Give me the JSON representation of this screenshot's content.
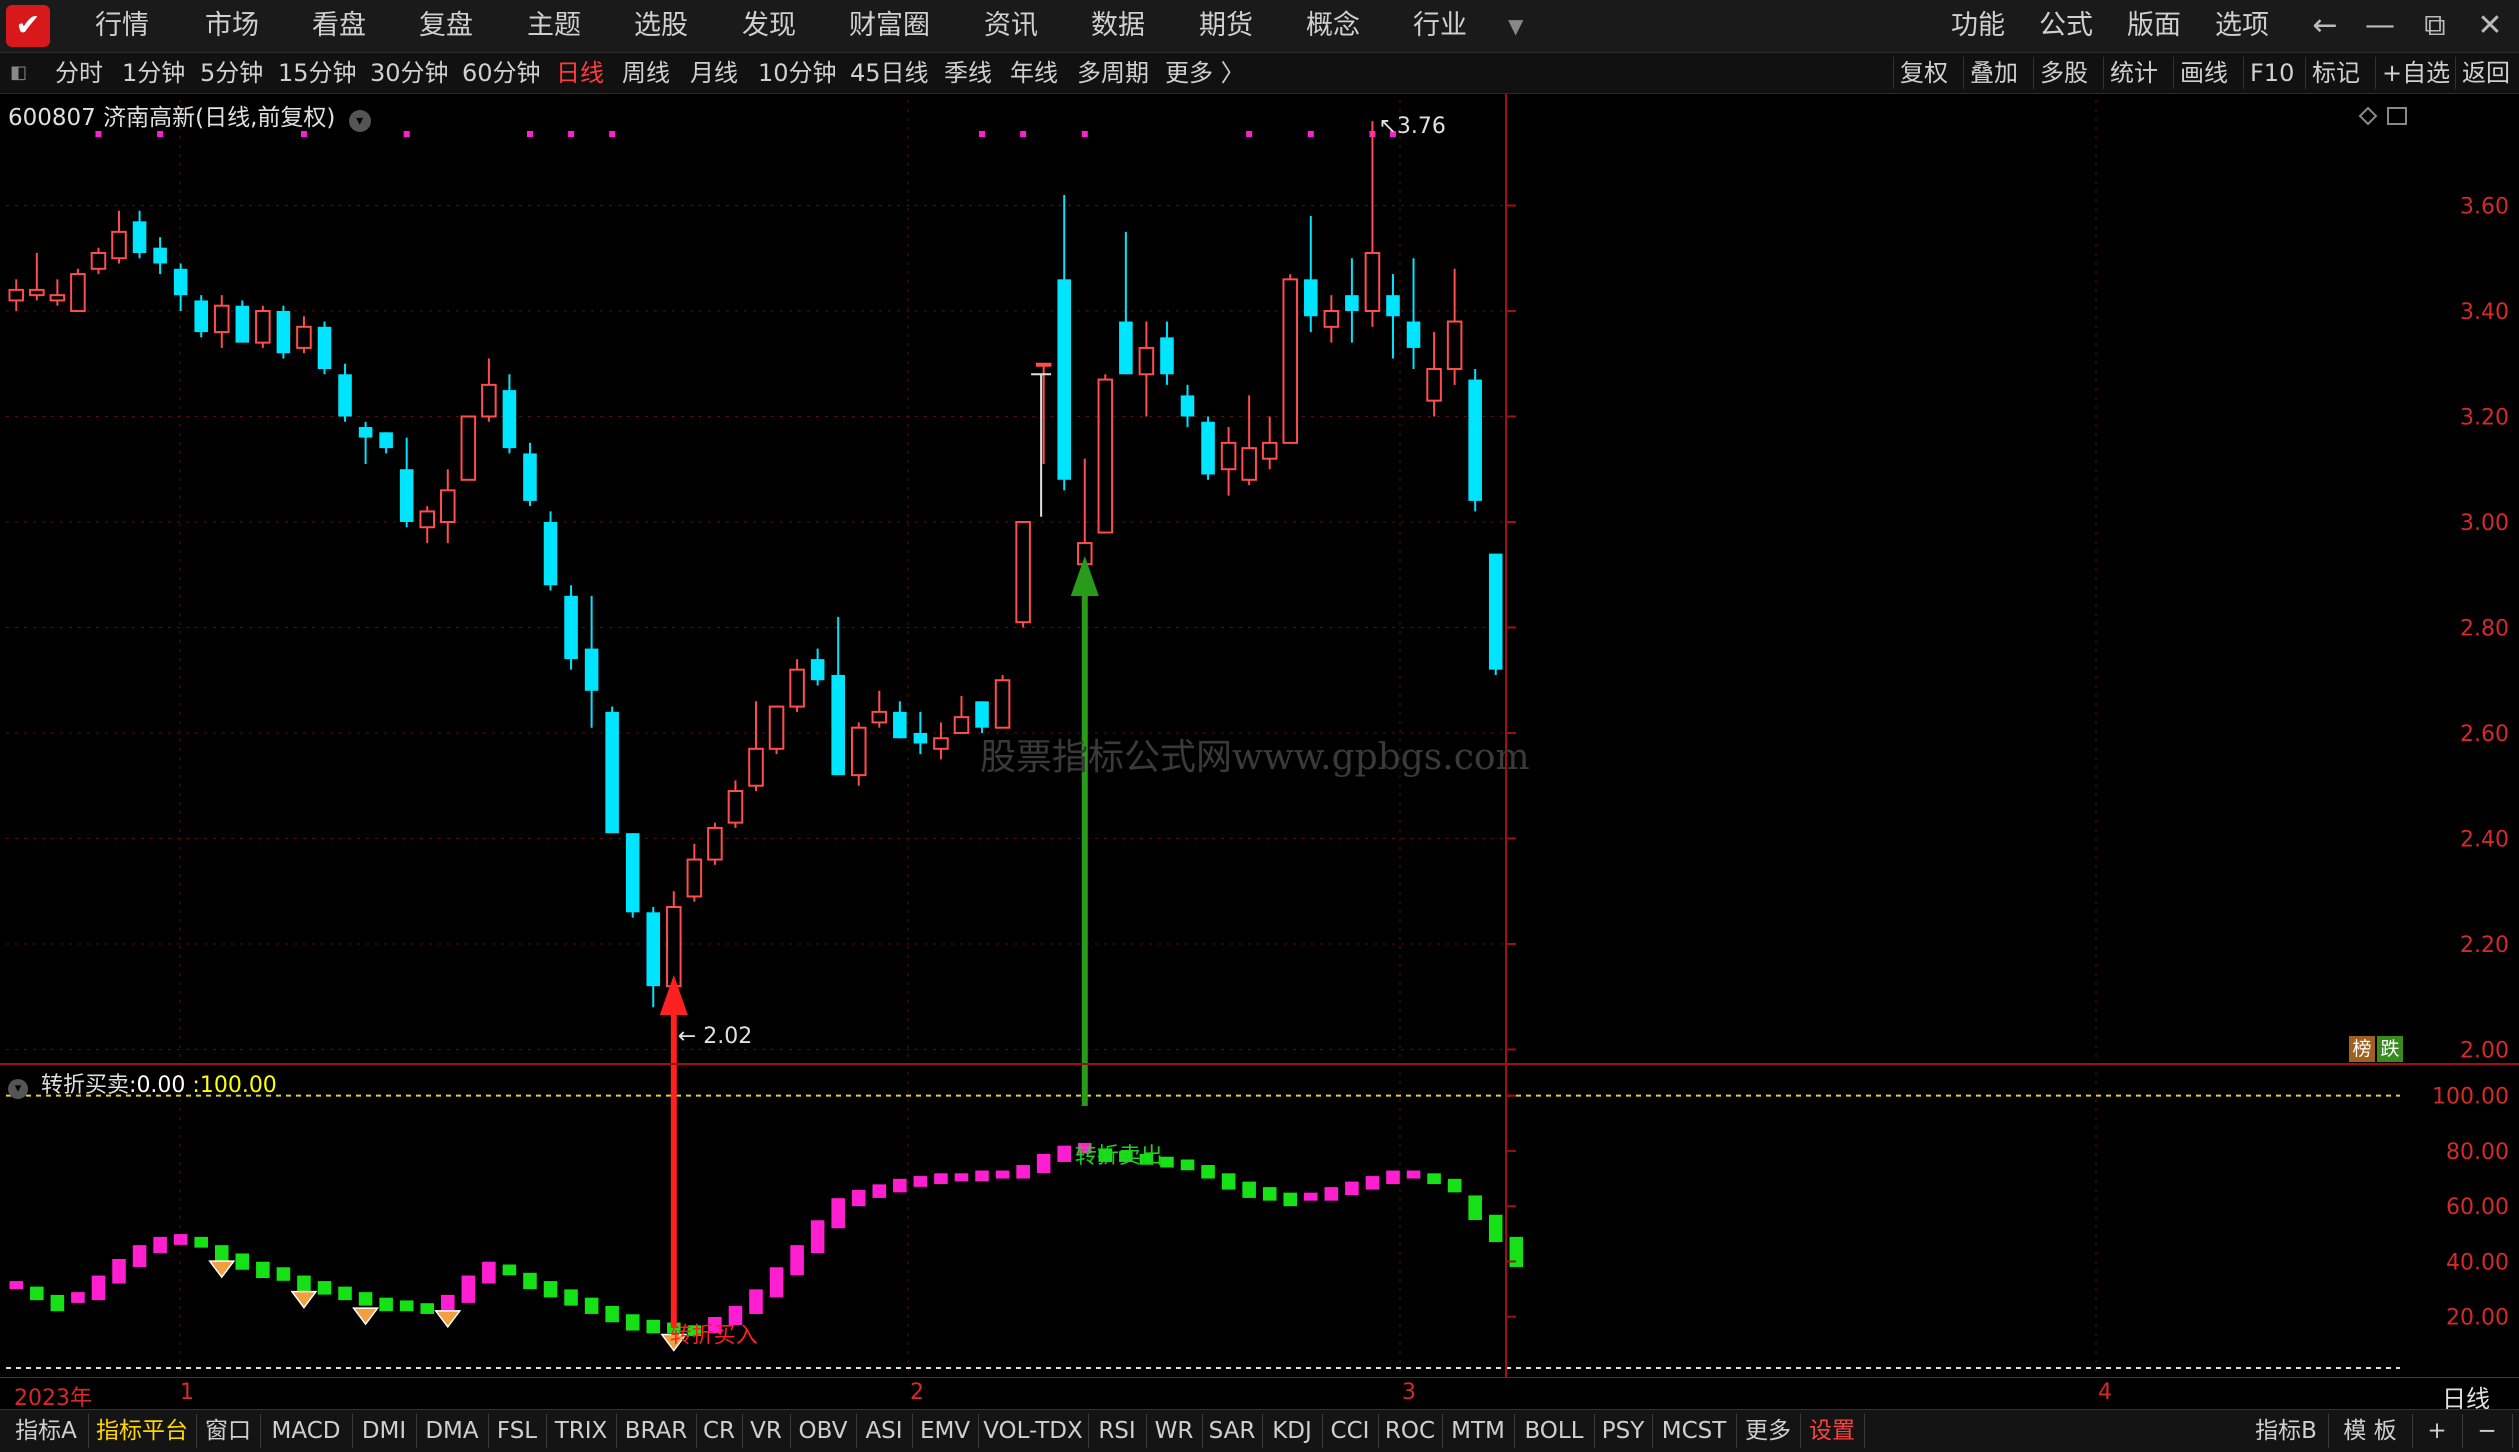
{
  "menubar": {
    "items": [
      "行情",
      "市场",
      "看盘",
      "复盘",
      "主题",
      "选股",
      "发现",
      "财富圈",
      "资讯",
      "数据",
      "期货",
      "概念",
      "行业"
    ],
    "right_items": [
      "功能",
      "公式",
      "版面",
      "选项"
    ],
    "window_buttons": [
      "back-arrow-icon",
      "minimize-icon",
      "restore-icon",
      "close-icon"
    ]
  },
  "periodbar": {
    "periods": [
      "分时",
      "1分钟",
      "5分钟",
      "15分钟",
      "30分钟",
      "60分钟",
      "日线",
      "周线",
      "月线",
      "10分钟",
      "45日线",
      "季线",
      "年线",
      "多周期",
      "更多 〉"
    ],
    "active": "日线",
    "tools": [
      "复权",
      "叠加",
      "多股",
      "统计",
      "画线",
      "F10",
      "标记",
      "+自选",
      "返回"
    ]
  },
  "stock": {
    "title": "600807 济南高新(日线,前复权)",
    "high_label": "3.76",
    "low_label": "2.02",
    "watermark": "股票指标公式网www.gpbgs.com",
    "badge_bang": "榜",
    "badge_die": "跌"
  },
  "indicator": {
    "name": "转折买卖",
    "value1": "0.00",
    "value2": "100.00",
    "buy_label": "转折买入",
    "sell_label": "转折卖出"
  },
  "axis": {
    "main_ticks": [
      "3.60",
      "3.40",
      "3.20",
      "3.00",
      "2.80",
      "2.60",
      "2.40",
      "2.20",
      "2.00"
    ],
    "sub_ticks": [
      "100.00",
      "80.00",
      "60.00",
      "40.00",
      "20.00"
    ],
    "date_labels": [
      "2023年",
      "1",
      "2",
      "3",
      "4"
    ],
    "period_label": "日线"
  },
  "colors": {
    "up": "#ff4d4d",
    "down": "#00e5ff",
    "ind_up": "#ff1fd1",
    "ind_down": "#16e016",
    "axis": "#a01010",
    "buy_arrow": "#ff2020",
    "sell_arrow": "#2a9a1a"
  },
  "chart_data": {
    "type": "candlestick",
    "candles": [
      [
        3.42,
        3.44,
        3.4,
        3.46
      ],
      [
        3.43,
        3.44,
        3.42,
        3.51
      ],
      [
        3.42,
        3.43,
        3.41,
        3.46
      ],
      [
        3.4,
        3.47,
        3.4,
        3.48
      ],
      [
        3.48,
        3.51,
        3.47,
        3.52
      ],
      [
        3.5,
        3.55,
        3.49,
        3.59
      ],
      [
        3.57,
        3.51,
        3.5,
        3.59
      ],
      [
        3.52,
        3.49,
        3.47,
        3.54
      ],
      [
        3.48,
        3.43,
        3.4,
        3.49
      ],
      [
        3.42,
        3.36,
        3.35,
        3.43
      ],
      [
        3.36,
        3.41,
        3.33,
        3.43
      ],
      [
        3.41,
        3.34,
        3.34,
        3.42
      ],
      [
        3.34,
        3.4,
        3.33,
        3.41
      ],
      [
        3.4,
        3.32,
        3.31,
        3.41
      ],
      [
        3.33,
        3.37,
        3.32,
        3.39
      ],
      [
        3.37,
        3.29,
        3.28,
        3.38
      ],
      [
        3.28,
        3.2,
        3.19,
        3.3
      ],
      [
        3.18,
        3.16,
        3.11,
        3.19
      ],
      [
        3.17,
        3.14,
        3.13,
        3.17
      ],
      [
        3.1,
        3.0,
        2.99,
        3.16
      ],
      [
        2.99,
        3.02,
        2.96,
        3.03
      ],
      [
        3.0,
        3.06,
        2.96,
        3.1
      ],
      [
        3.08,
        3.2,
        3.08,
        3.2
      ],
      [
        3.2,
        3.26,
        3.19,
        3.31
      ],
      [
        3.25,
        3.14,
        3.13,
        3.28
      ],
      [
        3.13,
        3.04,
        3.03,
        3.15
      ],
      [
        3.0,
        2.88,
        2.87,
        3.02
      ],
      [
        2.86,
        2.74,
        2.72,
        2.88
      ],
      [
        2.76,
        2.68,
        2.61,
        2.86
      ],
      [
        2.64,
        2.41,
        2.41,
        2.65
      ],
      [
        2.41,
        2.26,
        2.25,
        2.41
      ],
      [
        2.26,
        2.12,
        2.08,
        2.27
      ],
      [
        2.12,
        2.27,
        2.02,
        2.3
      ],
      [
        2.29,
        2.36,
        2.28,
        2.39
      ],
      [
        2.36,
        2.42,
        2.35,
        2.43
      ],
      [
        2.43,
        2.49,
        2.42,
        2.51
      ],
      [
        2.5,
        2.57,
        2.49,
        2.66
      ],
      [
        2.57,
        2.65,
        2.56,
        2.65
      ],
      [
        2.65,
        2.72,
        2.64,
        2.74
      ],
      [
        2.74,
        2.7,
        2.69,
        2.76
      ],
      [
        2.71,
        2.52,
        2.52,
        2.82
      ],
      [
        2.52,
        2.61,
        2.5,
        2.62
      ],
      [
        2.62,
        2.64,
        2.61,
        2.68
      ],
      [
        2.64,
        2.59,
        2.59,
        2.66
      ],
      [
        2.6,
        2.58,
        2.56,
        2.64
      ],
      [
        2.57,
        2.59,
        2.55,
        2.62
      ],
      [
        2.6,
        2.63,
        2.6,
        2.67
      ],
      [
        2.66,
        2.61,
        2.6,
        2.66
      ],
      [
        2.61,
        2.7,
        2.61,
        2.71
      ],
      [
        2.81,
        3.0,
        2.8,
        3.0
      ],
      [
        3.3,
        3.3,
        3.11,
        3.3
      ],
      [
        3.46,
        3.08,
        3.06,
        3.62
      ],
      [
        2.92,
        2.96,
        2.92,
        3.12
      ],
      [
        2.98,
        3.27,
        2.98,
        3.28
      ],
      [
        3.38,
        3.28,
        3.28,
        3.55
      ],
      [
        3.28,
        3.33,
        3.2,
        3.38
      ],
      [
        3.35,
        3.28,
        3.26,
        3.38
      ],
      [
        3.24,
        3.2,
        3.18,
        3.26
      ],
      [
        3.19,
        3.09,
        3.08,
        3.2
      ],
      [
        3.1,
        3.15,
        3.05,
        3.18
      ],
      [
        3.08,
        3.14,
        3.07,
        3.24
      ],
      [
        3.12,
        3.15,
        3.1,
        3.2
      ],
      [
        3.15,
        3.46,
        3.15,
        3.47
      ],
      [
        3.46,
        3.39,
        3.36,
        3.58
      ],
      [
        3.37,
        3.4,
        3.34,
        3.43
      ],
      [
        3.43,
        3.4,
        3.34,
        3.5
      ],
      [
        3.4,
        3.51,
        3.37,
        3.76
      ],
      [
        3.43,
        3.39,
        3.31,
        3.47
      ],
      [
        3.38,
        3.33,
        3.29,
        3.5
      ],
      [
        3.23,
        3.29,
        3.2,
        3.36
      ],
      [
        3.29,
        3.38,
        3.26,
        3.48
      ],
      [
        3.27,
        3.04,
        3.02,
        3.29
      ],
      [
        2.94,
        2.72,
        2.71,
        2.94
      ]
    ],
    "indicator_values": [
      30,
      28,
      25,
      26,
      32,
      38,
      43,
      46,
      47,
      46,
      43,
      40,
      37,
      35,
      32,
      30,
      28,
      26,
      24,
      23,
      22,
      25,
      32,
      37,
      36,
      33,
      30,
      27,
      24,
      21,
      18,
      16,
      15,
      14,
      17,
      21,
      27,
      35,
      43,
      52,
      60,
      63,
      65,
      67,
      68,
      69,
      69,
      70,
      70,
      72,
      76,
      79,
      80,
      78,
      77,
      76,
      75,
      74,
      72,
      69,
      66,
      64,
      62,
      62,
      64,
      66,
      68,
      70,
      70,
      69,
      67,
      61,
      54,
      46
    ],
    "signals": [
      {
        "type": "buy",
        "label": "转折买入",
        "index": 32
      },
      {
        "type": "sell",
        "label": "转折卖出",
        "index": 52
      }
    ],
    "main_ylim": [
      1.98,
      3.8
    ],
    "sub_ylim": [
      0,
      110
    ]
  },
  "tabs": {
    "items": [
      "指标A",
      "指标平台",
      "窗口",
      "MACD",
      "DMI",
      "DMA",
      "FSL",
      "TRIX",
      "BRAR",
      "CR",
      "VR",
      "OBV",
      "ASI",
      "EMV",
      "VOL-TDX",
      "RSI",
      "WR",
      "SAR",
      "KDJ",
      "CCI",
      "ROC",
      "MTM",
      "BOLL",
      "PSY",
      "MCST",
      "更多",
      "设置"
    ],
    "right": [
      "指标B",
      "模 板",
      "+",
      "−"
    ]
  }
}
